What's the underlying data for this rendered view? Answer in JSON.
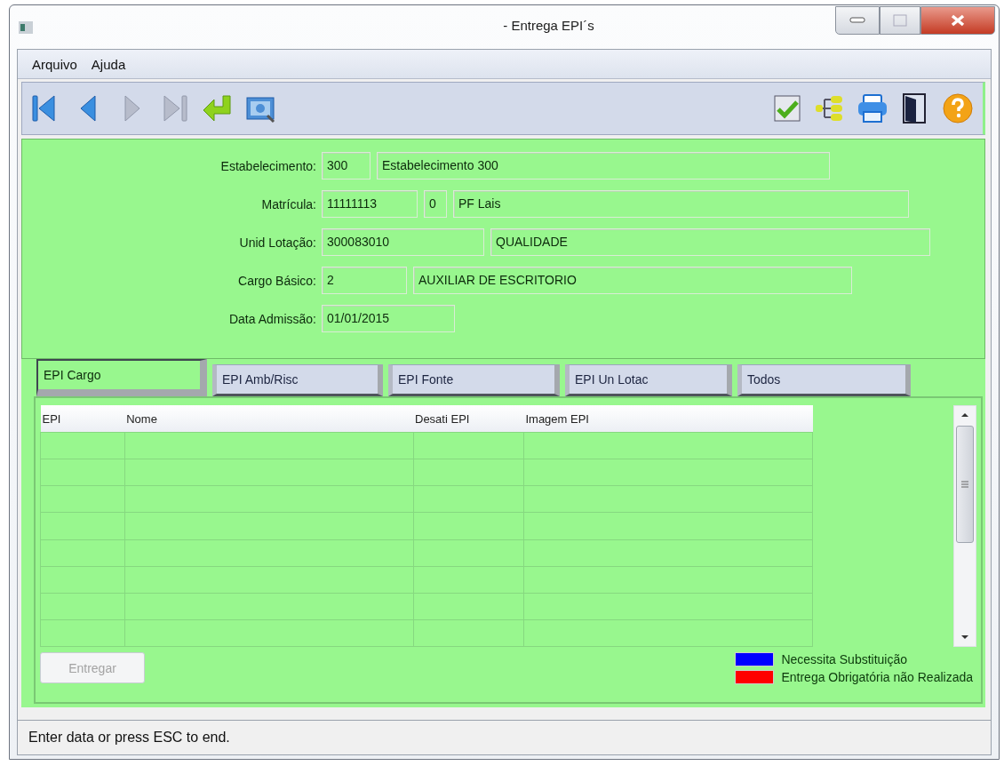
{
  "window": {
    "title": "- Entrega EPI´s"
  },
  "menu": [
    "Arquivo",
    "Ajuda"
  ],
  "toolbar": [
    {
      "kind": "first",
      "disabled": false
    },
    {
      "kind": "prev",
      "disabled": false
    },
    {
      "kind": "next",
      "disabled": true
    },
    {
      "kind": "last",
      "disabled": true
    },
    {
      "kind": "return",
      "disabled": false
    },
    {
      "kind": "view",
      "disabled": false
    },
    {
      "kind": "checklist",
      "disabled": false
    },
    {
      "kind": "tree",
      "disabled": false
    },
    {
      "kind": "print",
      "disabled": false
    },
    {
      "kind": "exit",
      "disabled": false
    },
    {
      "kind": "help",
      "disabled": false
    }
  ],
  "form": [
    {
      "label": "Estabelecimento:",
      "fields": [
        {
          "value": "300"
        },
        {
          "value": "Estabelecimento 300"
        }
      ]
    },
    {
      "label": "Matrícula:",
      "fields": [
        {
          "value": "11111113"
        },
        {
          "value": "0"
        },
        {
          "value": "PF Lais"
        }
      ]
    },
    {
      "label": "Unid Lotação:",
      "fields": [
        {
          "value": "300083010"
        },
        {
          "value": "QUALIDADE"
        }
      ]
    },
    {
      "label": "Cargo Básico:",
      "fields": [
        {
          "value": "2"
        },
        {
          "value": "AUXILIAR DE ESCRITORIO"
        }
      ]
    },
    {
      "label": "Data Admissão:",
      "fields": [
        {
          "value": "01/01/2015"
        }
      ]
    }
  ],
  "tabs": [
    {
      "label": "EPI Cargo",
      "selected": true
    },
    {
      "label": "EPI  Amb/Risc",
      "selected": false
    },
    {
      "label": "EPI Fonte",
      "selected": false
    },
    {
      "label": "EPI Un Lotac",
      "selected": false
    },
    {
      "label": "Todos",
      "selected": false
    }
  ],
  "table": {
    "columns": [
      "EPI",
      "Nome",
      "Desati EPI",
      "Imagem EPI"
    ]
  },
  "deliver_button": {
    "label": "Entregar",
    "disabled": true
  },
  "legend": [
    {
      "label": "Necessita Substituição",
      "color": "#0000ff"
    },
    {
      "label": "Entrega Obrigatória não Realizada",
      "color": "#ff0000"
    }
  ],
  "status_bar": "Enter data or press ESC to end."
}
